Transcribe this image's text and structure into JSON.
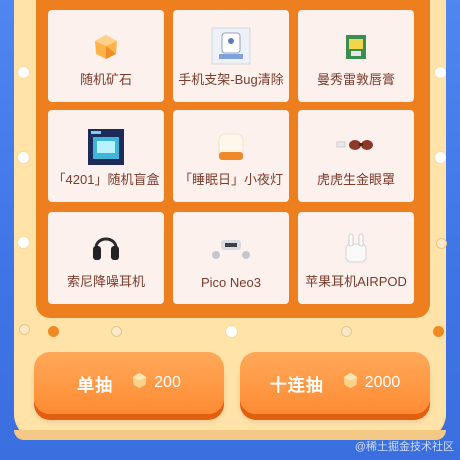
{
  "prizes": [
    {
      "name": "随机矿石",
      "icon": "ore-icon"
    },
    {
      "name": "手机支架-Bug清除",
      "icon": "phone-stand-icon"
    },
    {
      "name": "曼秀雷敦唇膏",
      "icon": "lip-balm-icon"
    },
    {
      "name": "「4201」随机盲盒",
      "icon": "blind-box-icon"
    },
    {
      "name": "「睡眠日」小夜灯",
      "icon": "night-light-icon"
    },
    {
      "name": "虎虎生金眼罩",
      "icon": "eye-mask-icon"
    },
    {
      "name": "索尼降噪耳机",
      "icon": "headphones-icon"
    },
    {
      "name": "Pico Neo3",
      "icon": "vr-headset-icon"
    },
    {
      "name": "苹果耳机AIRPOD",
      "icon": "airpods-icon"
    }
  ],
  "buttons": {
    "single": {
      "label": "单抽",
      "cost": "200"
    },
    "ten": {
      "label": "十连抽",
      "cost": "2000"
    }
  },
  "watermark": "@稀土掘金技术社区",
  "colors": {
    "background": "#4f86f0",
    "panel": "#ffe3a8",
    "board": "#ee7f1f",
    "card": "#fdf1ee",
    "button": "#ff8b33"
  }
}
